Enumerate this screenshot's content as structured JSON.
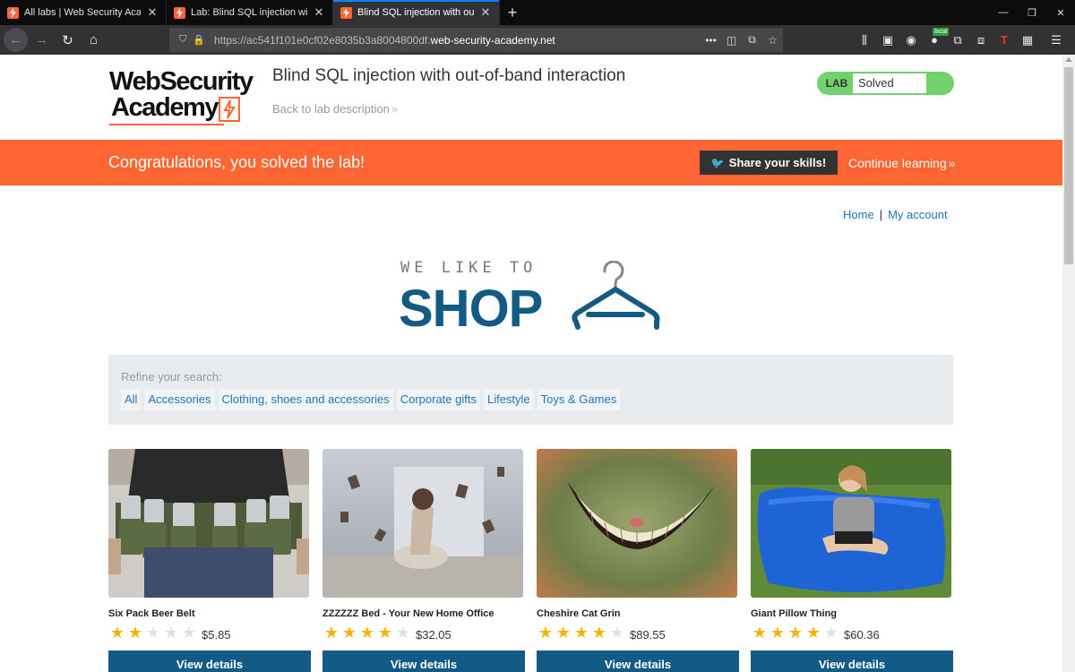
{
  "browser": {
    "tabs": [
      {
        "title": "All labs | Web Security Academy",
        "active": false
      },
      {
        "title": "Lab: Blind SQL injection with out-of-band interaction",
        "active": false
      },
      {
        "title": "Blind SQL injection with out-of-band interaction",
        "active": true
      }
    ],
    "url": {
      "prefix": "https://ac541f101e0cf02e8035b3a8004800df.",
      "domain": "web-security-academy.net"
    },
    "local_badge": "local",
    "icons": [
      "back-icon",
      "forward-icon",
      "reload-icon",
      "home-icon",
      "shield-icon",
      "lock-icon",
      "more-icon",
      "pocket-icon",
      "translate-icon",
      "bookmark-star-icon",
      "library-icon",
      "sidebar-icon",
      "account-icon",
      "extension-icon",
      "menu-icon"
    ]
  },
  "header": {
    "logo_line1": "WebSecurity",
    "logo_line2": "Academy",
    "lab_title": "Blind SQL injection with out-of-band interaction",
    "back_link": "Back to lab description",
    "lab_tag": "LAB",
    "lab_status": "Solved",
    "status_color": "#70d16d"
  },
  "notification": {
    "message": "Congratulations, you solved the lab!",
    "share_label": "Share your skills!",
    "continue_label": "Continue learning",
    "color": "#ff6633"
  },
  "nav": {
    "home": "Home",
    "separator": "|",
    "account": "My account"
  },
  "shop_logo": {
    "tagline": "WE LIKE TO",
    "word": "SHOP"
  },
  "refine": {
    "label": "Refine your search:",
    "filters": [
      "All",
      "Accessories",
      "Clothing, shoes and accessories",
      "Corporate gifts",
      "Lifestyle",
      "Toys & Games"
    ]
  },
  "products": [
    {
      "name": "Six Pack Beer Belt",
      "rating": 2,
      "price": "$5.85",
      "button": "View details"
    },
    {
      "name": "ZZZZZZ Bed - Your New Home Office",
      "rating": 4,
      "price": "$32.05",
      "button": "View details"
    },
    {
      "name": "Cheshire Cat Grin",
      "rating": 4,
      "price": "$89.55",
      "button": "View details"
    },
    {
      "name": "Giant Pillow Thing",
      "rating": 4,
      "price": "$60.36",
      "button": "View details"
    }
  ]
}
